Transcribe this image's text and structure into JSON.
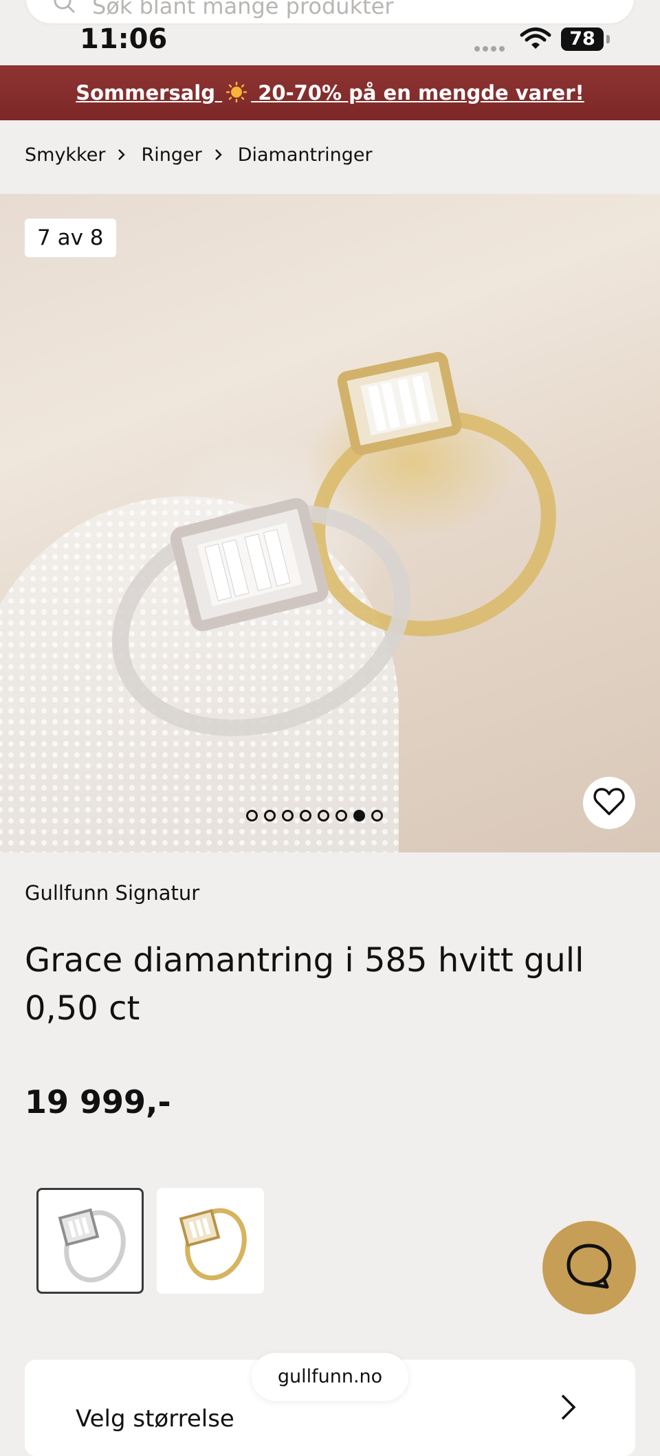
{
  "search": {
    "placeholder": "Søk blant mange produkter"
  },
  "status_bar": {
    "time": "11:06",
    "battery": "78"
  },
  "promo": {
    "text_before": "Sommersalg",
    "text_after": "20-70% på en mengde varer!",
    "sun_icon": "sun-icon"
  },
  "breadcrumb": {
    "items": [
      "Smykker",
      "Ringer",
      "Diamantringer"
    ]
  },
  "gallery": {
    "counter": "7 av 8",
    "total_images": 8,
    "active_index": 7
  },
  "product": {
    "brand": "Gullfunn Signatur",
    "title": "Grace diamantring i 585 hvitt gull 0,50 ct",
    "price": "19 999,-",
    "variants": [
      {
        "name": "white gold",
        "selected": true
      },
      {
        "name": "yellow gold",
        "selected": false
      }
    ]
  },
  "size_selector": {
    "label": "Velg størrelse"
  },
  "browser": {
    "domain": "gullfunn.no"
  },
  "colors": {
    "promo_bg": "#862f2e",
    "chat_button": "#c79e55",
    "page_bg": "#f1efed"
  }
}
